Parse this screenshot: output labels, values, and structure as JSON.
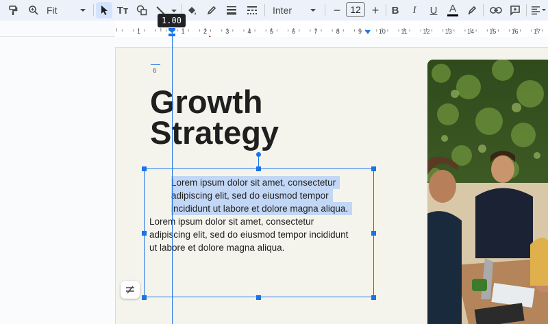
{
  "toolbar": {
    "zoom_value": "Fit",
    "font_name": "Inter",
    "font_size": "12",
    "minus_label": "−",
    "plus_label": "+",
    "bold_label": "B",
    "italic_label": "I",
    "underline_label": "U",
    "text_color_label": "A",
    "text_style_label": "Tт",
    "icons": [
      "paint-format-icon",
      "zoom-icon",
      "select-arrow-icon",
      "text-style-icon",
      "shape-icon",
      "line-icon",
      "fill-color-icon",
      "border-color-icon",
      "border-weight-icon",
      "border-dash-icon",
      "bold-icon",
      "italic-icon",
      "underline-icon",
      "text-color-icon",
      "highlight-icon",
      "link-icon",
      "comment-icon",
      "align-icon"
    ]
  },
  "ruler": {
    "tooltip": "1.00",
    "numbers": [
      "1",
      "1",
      "2",
      "3",
      "4",
      "5",
      "6",
      "7",
      "8",
      "9",
      "10",
      "11",
      "12",
      "13",
      "14",
      "15",
      "16",
      "17"
    ]
  },
  "slide": {
    "page_number": "6",
    "title_line1": "Growth",
    "title_line2": "Strategy",
    "paragraph_selected": [
      "Lorem ipsum dolor sit amet, consectetur",
      "adipiscing elit, sed do eiusmod tempor",
      "incididunt ut labore et dolore magna aliqua."
    ],
    "paragraph_body": [
      "Lorem ipsum dolor sit amet, consectetur",
      "adipiscing elit, sed do eiusmod tempor incididunt",
      "ut labore et dolore magna aliqua."
    ]
  },
  "colors": {
    "accent": "#1a73e8",
    "slide_bg": "#f5f4ec",
    "selection": "#c2d7f5",
    "title": "#1f1f1f",
    "indent_arrow": "#d93025"
  }
}
